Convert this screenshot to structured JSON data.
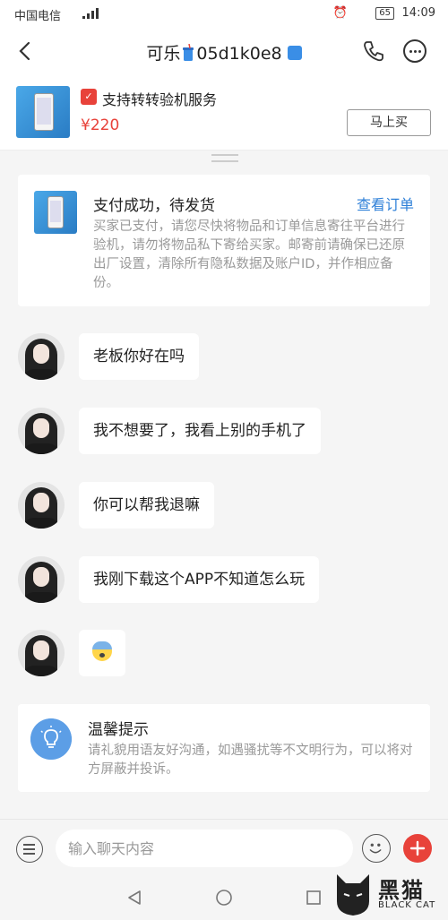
{
  "status_bar": {
    "carrier": "中国电信",
    "network": "4G",
    "battery": "65",
    "time": "14:09"
  },
  "header": {
    "title_part1": "可乐",
    "title_part2": "05d1k0e8"
  },
  "product": {
    "service": "支持转转验机服务",
    "price": "¥220",
    "buy_label": "马上买"
  },
  "order_card": {
    "title": "支付成功，待发货",
    "view_label": "查看订单",
    "description": "买家已支付，请您尽快将物品和订单信息寄往平台进行验机，请勿将物品私下寄给买家。邮寄前请确保已还原出厂设置，清除所有隐私数据及账户ID，并作相应备份。"
  },
  "messages": [
    {
      "text": "老板你好在吗"
    },
    {
      "text": "我不想要了，我看上别的手机了"
    },
    {
      "text": "你可以帮我退嘛"
    },
    {
      "text": "我刚下载这个APP不知道怎么玩"
    },
    {
      "text": "",
      "emoji": "fearful-face-emoji"
    }
  ],
  "tip": {
    "title": "温馨提示",
    "text": "请礼貌用语友好沟通，如遇骚扰等不文明行为，可以将对方屏蔽并投诉。"
  },
  "input_bar": {
    "placeholder": "输入聊天内容"
  },
  "watermark": {
    "text": "黑猫",
    "sub": "BLACK CAT"
  },
  "colors": {
    "accent_red": "#e8423a",
    "link_blue": "#2f80d8"
  }
}
